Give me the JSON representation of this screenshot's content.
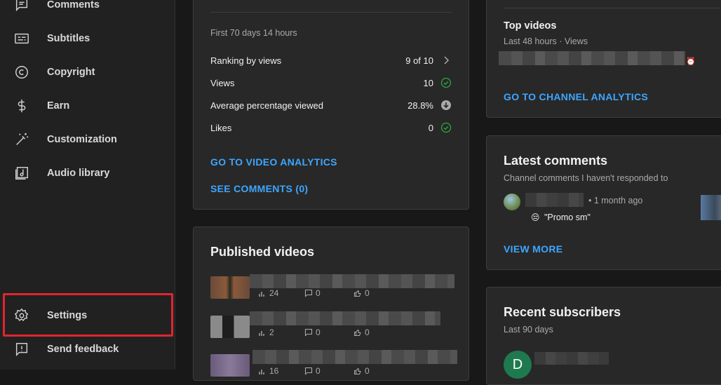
{
  "sidebar": {
    "items": [
      {
        "label": "Comments",
        "icon": "comments-icon"
      },
      {
        "label": "Subtitles",
        "icon": "subtitles-icon"
      },
      {
        "label": "Copyright",
        "icon": "copyright-icon"
      },
      {
        "label": "Earn",
        "icon": "dollar-icon"
      },
      {
        "label": "Customization",
        "icon": "magic-wand-icon"
      },
      {
        "label": "Audio library",
        "icon": "music-note-icon"
      },
      {
        "label": "Settings",
        "icon": "gear-icon"
      },
      {
        "label": "Send feedback",
        "icon": "feedback-icon"
      }
    ],
    "highlight_color": "#e0262e"
  },
  "latest_video": {
    "period": "First 70 days 14 hours",
    "rows": [
      {
        "label": "Ranking by views",
        "value": "9 of 10",
        "icon": "chevron-right-icon"
      },
      {
        "label": "Views",
        "value": "10",
        "icon": "check-circle-icon"
      },
      {
        "label": "Average percentage viewed",
        "value": "28.8%",
        "icon": "arrow-down-circle-icon"
      },
      {
        "label": "Likes",
        "value": "0",
        "icon": "check-circle-icon"
      }
    ],
    "analytics_link": "GO TO VIDEO ANALYTICS",
    "comments_link": "SEE COMMENTS (0)"
  },
  "published": {
    "title": "Published videos",
    "videos": [
      {
        "views": "24",
        "comments": "0",
        "likes": "0"
      },
      {
        "views": "2",
        "comments": "0",
        "likes": "0"
      },
      {
        "views": "16",
        "comments": "0",
        "likes": "0"
      }
    ]
  },
  "top_videos": {
    "title": "Top videos",
    "subtitle": "Last 48 hours · Views",
    "link": "GO TO CHANNEL ANALYTICS"
  },
  "latest_comments": {
    "title": "Latest comments",
    "subtitle": "Channel comments I haven't responded to",
    "time": "• 1 month ago",
    "comment_text": "\"Promo sm\"",
    "link": "VIEW MORE"
  },
  "recent_subscribers": {
    "title": "Recent subscribers",
    "subtitle": "Last 90 days",
    "avatar_letter": "D",
    "avatar_color": "#1e7a4e"
  },
  "colors": {
    "accent": "#3ea6ff",
    "check": "#2ba640"
  }
}
